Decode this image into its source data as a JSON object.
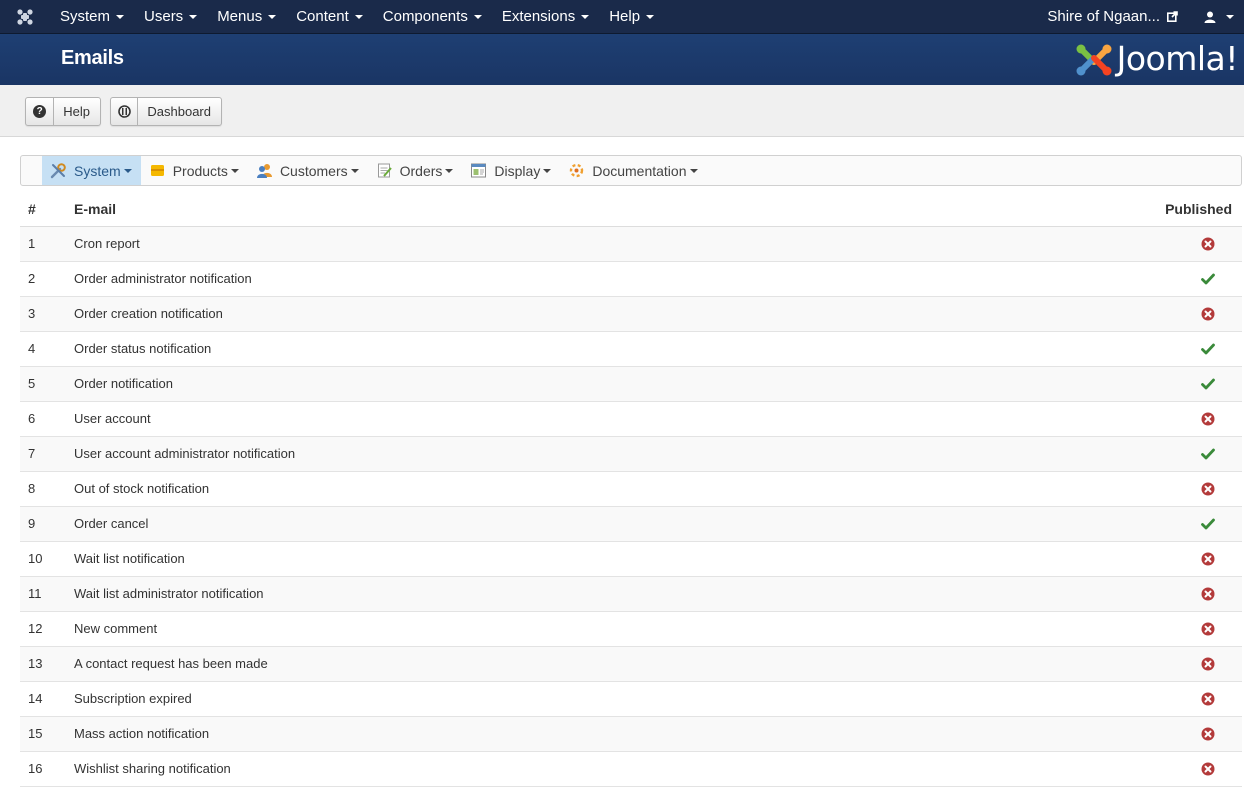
{
  "topnav": {
    "menu": [
      {
        "label": "System"
      },
      {
        "label": "Users"
      },
      {
        "label": "Menus"
      },
      {
        "label": "Content"
      },
      {
        "label": "Components"
      },
      {
        "label": "Extensions"
      },
      {
        "label": "Help"
      }
    ],
    "site_label": "Shire of Ngaan..."
  },
  "header": {
    "title": "Emails",
    "logo_text": "Joomla!"
  },
  "toolbar": {
    "help_label": "Help",
    "dashboard_label": "Dashboard"
  },
  "submenu": [
    {
      "label": "System",
      "icon": "tools-icon",
      "active": true
    },
    {
      "label": "Products",
      "icon": "products-icon",
      "active": false
    },
    {
      "label": "Customers",
      "icon": "customers-icon",
      "active": false
    },
    {
      "label": "Orders",
      "icon": "orders-icon",
      "active": false
    },
    {
      "label": "Display",
      "icon": "display-icon",
      "active": false
    },
    {
      "label": "Documentation",
      "icon": "documentation-icon",
      "active": false
    }
  ],
  "table": {
    "headers": {
      "num": "#",
      "email": "E-mail",
      "published": "Published"
    },
    "rows": [
      {
        "num": "1",
        "email": "Cron report",
        "published": false
      },
      {
        "num": "2",
        "email": "Order administrator notification",
        "published": true
      },
      {
        "num": "3",
        "email": "Order creation notification",
        "published": false
      },
      {
        "num": "4",
        "email": "Order status notification",
        "published": true
      },
      {
        "num": "5",
        "email": "Order notification",
        "published": true
      },
      {
        "num": "6",
        "email": "User account",
        "published": false
      },
      {
        "num": "7",
        "email": "User account administrator notification",
        "published": true
      },
      {
        "num": "8",
        "email": "Out of stock notification",
        "published": false
      },
      {
        "num": "9",
        "email": "Order cancel",
        "published": true
      },
      {
        "num": "10",
        "email": "Wait list notification",
        "published": false
      },
      {
        "num": "11",
        "email": "Wait list administrator notification",
        "published": false
      },
      {
        "num": "12",
        "email": "New comment",
        "published": false
      },
      {
        "num": "13",
        "email": "A contact request has been made",
        "published": false
      },
      {
        "num": "14",
        "email": "Subscription expired",
        "published": false
      },
      {
        "num": "15",
        "email": "Mass action notification",
        "published": false
      },
      {
        "num": "16",
        "email": "Wishlist sharing notification",
        "published": false
      }
    ]
  },
  "colors": {
    "topnav_bg": "#1a2a4a",
    "header_bg": "#1d3b6d",
    "published_green": "#3a8a3a",
    "unpublished_red": "#b33a3a",
    "submenu_active": "#c6e0f4"
  }
}
